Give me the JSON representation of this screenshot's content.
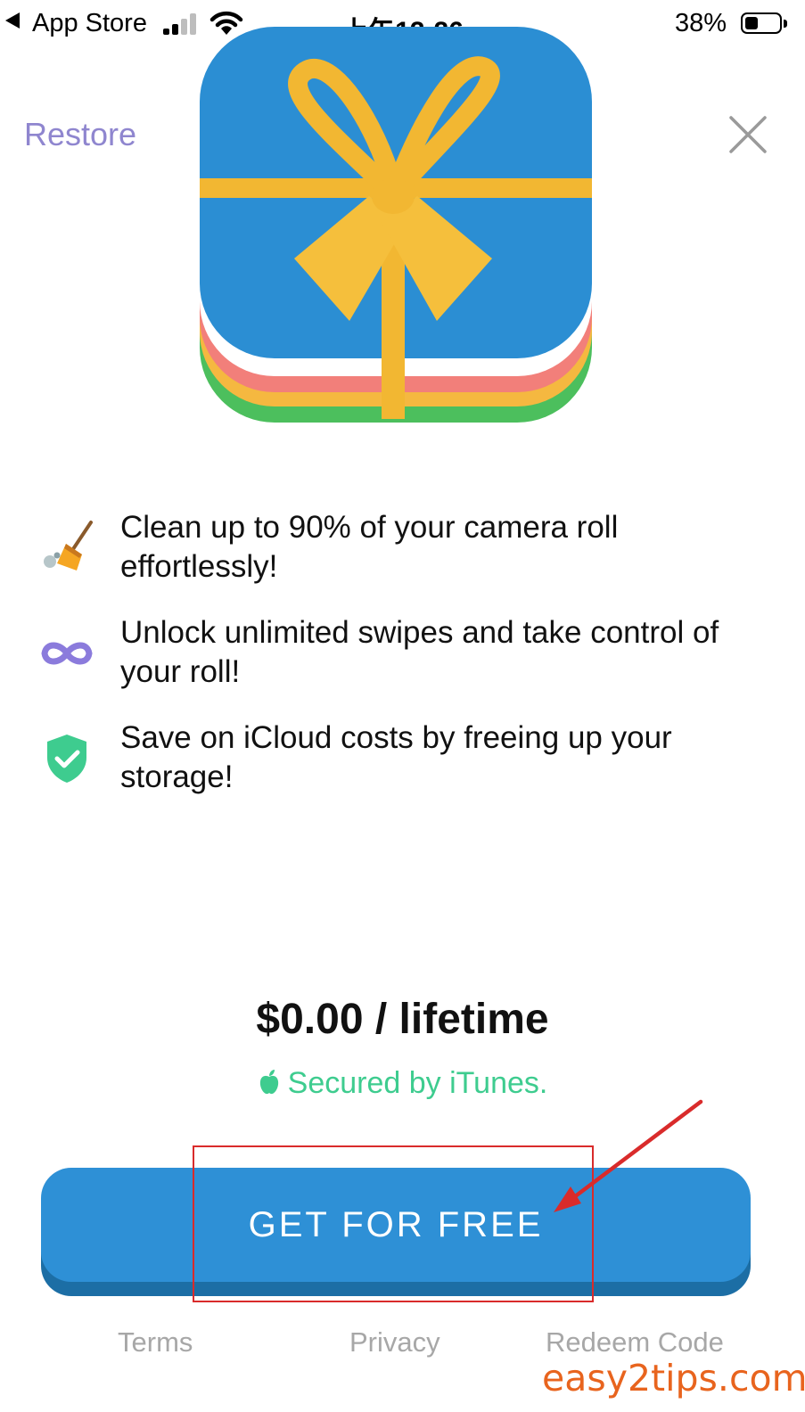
{
  "status_bar": {
    "back_app": "App Store",
    "time": "上午12:26",
    "battery_percent": "38%",
    "battery_level": 0.38
  },
  "header": {
    "restore_label": "Restore",
    "close_icon": "close-icon"
  },
  "hero": {
    "icon": "gift-box-icon"
  },
  "features": [
    {
      "icon": "broom-icon",
      "text": "Clean up to 90% of your camera roll effortlessly!"
    },
    {
      "icon": "infinity-icon",
      "text": "Unlock unlimited swipes and take control of your roll!"
    },
    {
      "icon": "shield-check-icon",
      "text": "Save on iCloud costs by freeing up your storage!"
    }
  ],
  "pricing": {
    "price_text": "$0.00 / lifetime",
    "secured_text": "Secured by iTunes."
  },
  "cta": {
    "label": "GET FOR FREE"
  },
  "footer": {
    "terms": "Terms",
    "privacy": "Privacy",
    "redeem_code": "Redeem Code"
  },
  "watermark": "easy2tips.com",
  "colors": {
    "restore": "#8f86cf",
    "secured": "#3ecc8f",
    "cta": "#2e90d6",
    "annotation": "#d92b2b",
    "watermark": "#e8641e"
  }
}
